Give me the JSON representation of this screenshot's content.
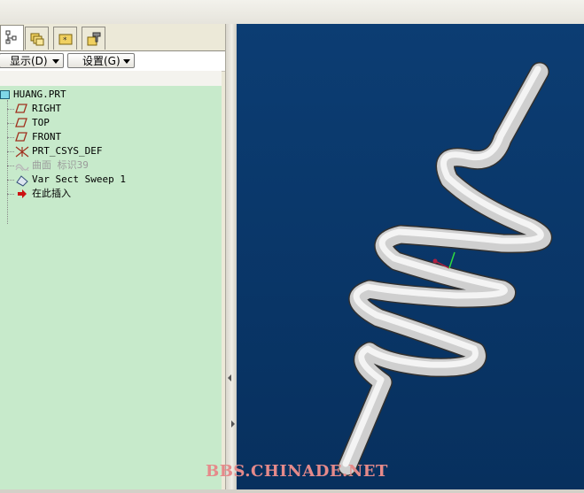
{
  "toolbar": {
    "display_label": "显示(D)",
    "settings_label": "设置(G)"
  },
  "tabs": [
    {
      "icon": "model-tree-icon",
      "active": true
    },
    {
      "icon": "folder-browser-icon",
      "active": false
    },
    {
      "icon": "favorites-folder-icon",
      "active": false
    },
    {
      "icon": "connections-icon",
      "active": false
    }
  ],
  "tree": {
    "root": "HUANG.PRT",
    "items": [
      {
        "label": "RIGHT",
        "icon": "datum-plane-icon"
      },
      {
        "label": "TOP",
        "icon": "datum-plane-icon"
      },
      {
        "label": "FRONT",
        "icon": "datum-plane-icon"
      },
      {
        "label": "PRT_CSYS_DEF",
        "icon": "coordinate-system-icon"
      },
      {
        "label": "曲面 标识39",
        "icon": "surface-icon"
      },
      {
        "label": "Var Sect Sweep 1",
        "icon": "var-sect-sweep-icon"
      },
      {
        "label": "在此插入",
        "icon": "insert-here-arrow-icon"
      }
    ]
  },
  "watermark": "BBS.CHINADE.NET",
  "colors": {
    "tree_bg": "#c7eacb",
    "viewport_top": "#0b3a6e",
    "viewport_bottom": "#062f5c",
    "spring": "#d8d8d8",
    "insert_arrow": "#cc1111"
  }
}
